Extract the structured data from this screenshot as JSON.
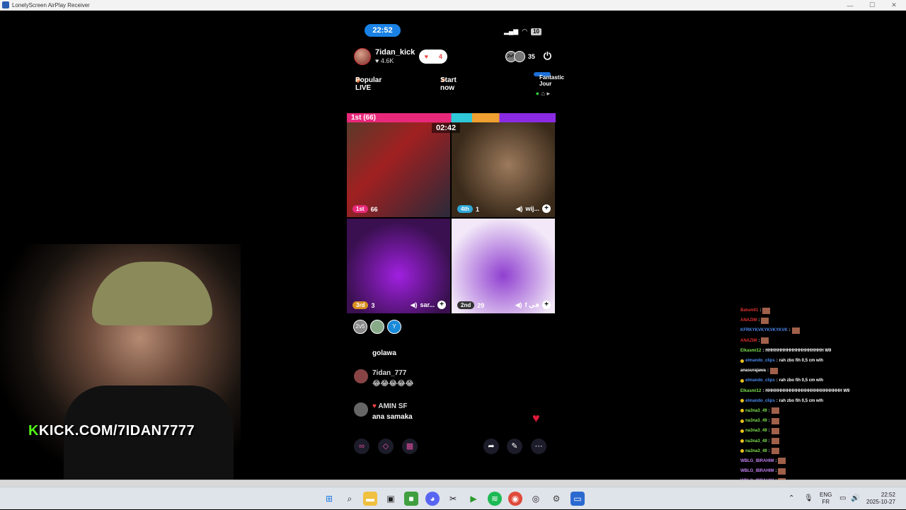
{
  "window": {
    "title": "LonelyScreen AirPlay Receiver"
  },
  "phone": {
    "status": {
      "time": "22:52",
      "battery": "10"
    },
    "host": {
      "name": "7idan_kick",
      "likes": "4.6K",
      "follow_count": "4"
    },
    "viewers": {
      "count": "35",
      "avatar_label": "2v5"
    },
    "pills": {
      "popular": "Popular LIVE",
      "start": "Start now",
      "journey": "Fantastic Jour"
    },
    "battle": {
      "label": "1st (66)",
      "timer": "02:42"
    },
    "tiles": [
      {
        "rank": "1st",
        "score": "66",
        "rank_color": "#e8287a",
        "name": ""
      },
      {
        "rank": "4th",
        "score": "1",
        "rank_color": "#2ea8d8",
        "name": "wij..."
      },
      {
        "rank": "3rd",
        "score": "3",
        "rank_color": "#d89020",
        "name": "sar..."
      },
      {
        "rank": "2nd",
        "score": "29",
        "rank_color": "#333333",
        "name": "f في"
      }
    ],
    "gifters": [
      {
        "label": "2v5",
        "num": "3"
      },
      {
        "label": "",
        "num": "2"
      },
      {
        "label": "Y",
        "num": "1"
      }
    ],
    "chat": [
      {
        "user": "golawa",
        "text": ""
      },
      {
        "user": "7idan_777",
        "text": "😂😂😂😂😂"
      },
      {
        "user": "AMIN SF",
        "text": "ana samaka"
      }
    ]
  },
  "overlay": {
    "kick": "KICK.COM/7IDAN7777",
    "kick_k": "K"
  },
  "side_chat": [
    {
      "user": "Batum01",
      "text": "",
      "color": "#e03030",
      "emote": true,
      "dot": false
    },
    {
      "user": "ANAZIM",
      "text": "",
      "color": "#e03030",
      "emote": true,
      "dot": false
    },
    {
      "user": "KFRKYKVKYKVKYKVK",
      "text": "",
      "color": "#4a8af0",
      "emote": true,
      "dot": false
    },
    {
      "user": "ANAZIM",
      "text": "",
      "color": "#e03030",
      "emote": true,
      "dot": false
    },
    {
      "user": "Elkasmi12",
      "text": "HHHHHHHHHHHHHHHHHHH W9",
      "color": "#7ee050",
      "emote": false,
      "dot": false
    },
    {
      "user": "elmando_clips",
      "text": "rah zbo fih 0,5 cm wlh",
      "color": "#4a8af0",
      "emote": false,
      "dot": true
    },
    {
      "user": "anasurajawa",
      "text": "",
      "color": "#ffffff",
      "emote": true,
      "dot": false
    },
    {
      "user": "elmando_clips",
      "text": "rah zbo fih 0,5 cm wlh",
      "color": "#4a8af0",
      "emote": false,
      "dot": true
    },
    {
      "user": "Elkasmi12",
      "text": "HHHHHHHHHHHHHHHHHHHHHHHHH W9",
      "color": "#7ee050",
      "emote": false,
      "dot": false
    },
    {
      "user": "elmando_clips",
      "text": "rah zbo fih 0,5 cm wlh",
      "color": "#4a8af0",
      "emote": false,
      "dot": true
    },
    {
      "user": "na3na3_49",
      "text": "",
      "color": "#7ee050",
      "emote": true,
      "dot": true
    },
    {
      "user": "na3na3_49",
      "text": "",
      "color": "#7ee050",
      "emote": true,
      "dot": true
    },
    {
      "user": "na3na3_49",
      "text": "",
      "color": "#7ee050",
      "emote": true,
      "dot": true
    },
    {
      "user": "na3na3_49",
      "text": "",
      "color": "#7ee050",
      "emote": true,
      "dot": true
    },
    {
      "user": "na3na3_49",
      "text": "",
      "color": "#7ee050",
      "emote": true,
      "dot": true
    },
    {
      "user": "WBLG_IBRAHIM",
      "text": "",
      "color": "#c080f0",
      "emote": true,
      "dot": false
    },
    {
      "user": "WBLG_IBRAHIM",
      "text": "",
      "color": "#c080f0",
      "emote": true,
      "dot": false
    },
    {
      "user": "WBLG_IBRAHIM",
      "text": "",
      "color": "#c080f0",
      "emote": true,
      "dot": false
    }
  ],
  "taskbar": {
    "lang": "ENG",
    "layout": "FR",
    "time": "22:52",
    "date": "2025-10-27"
  }
}
